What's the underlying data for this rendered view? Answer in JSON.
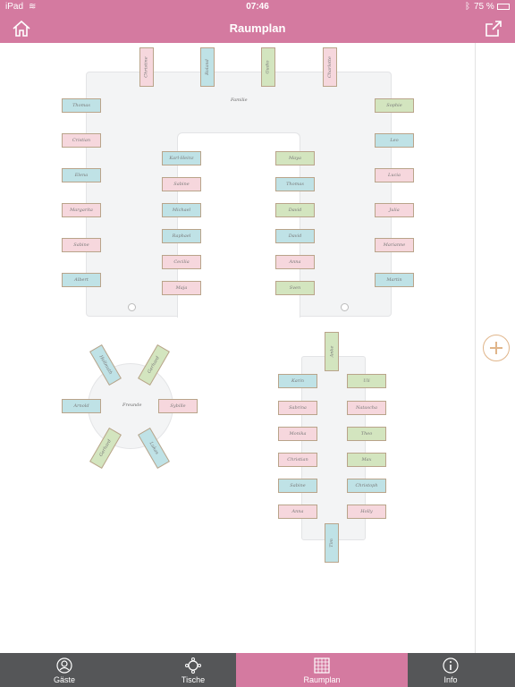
{
  "status": {
    "device": "iPad",
    "time": "07:46",
    "battery": "75 %"
  },
  "nav": {
    "title": "Raumplan",
    "home_icon": "home-icon",
    "export_icon": "export-icon"
  },
  "tables": [
    {
      "name": "Familie"
    },
    {
      "name": "Freunde"
    }
  ],
  "guests": {
    "top": [
      "Christine",
      "Roland",
      "Gudio",
      "Charlotte"
    ],
    "outer_left": [
      "Thomas",
      "Cristian",
      "Elena",
      "Margarita",
      "Sabine",
      "Albert"
    ],
    "outer_right": [
      "Sophie",
      "Leo",
      "Lucia",
      "Julia",
      "Marianne",
      "Martin"
    ],
    "inner_left": [
      "Karl-Heinz",
      "Sabine",
      "Michael",
      "Raphael",
      "Cecilia",
      "Maja"
    ],
    "inner_right": [
      "Maya",
      "Thomas",
      "David",
      "David",
      "Anna",
      "Sven"
    ],
    "round": [
      "Hellmuth",
      "Gerhard",
      "Arnold",
      "Sybille",
      "Gerhard",
      "Lukas"
    ],
    "rect_top": "Anke",
    "rect_left": [
      "Karin",
      "Sabrina",
      "Monika",
      "Christian",
      "Sabine",
      "Anna"
    ],
    "rect_right": [
      "Uli",
      "Natascha",
      "Theo",
      "Max",
      "Christoph",
      "Holly"
    ],
    "rect_bottom": "Tim"
  },
  "tabs": [
    {
      "label": "Gäste",
      "icon": "guests-icon"
    },
    {
      "label": "Tische",
      "icon": "tables-icon"
    },
    {
      "label": "Raumplan",
      "icon": "floorplan-icon"
    },
    {
      "label": "Info",
      "icon": "info-icon"
    }
  ],
  "colors": {
    "accent": "#d47aa0",
    "tabbar": "#555658",
    "pink": "#f6d7dd",
    "blue": "#bfe2e6",
    "green": "#d3e5bf"
  }
}
